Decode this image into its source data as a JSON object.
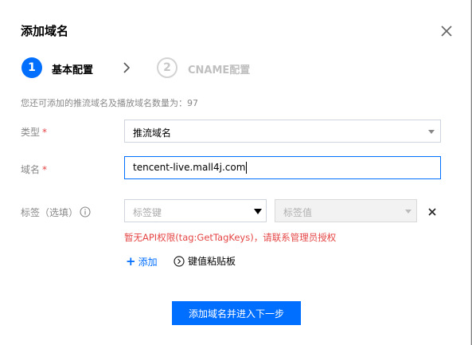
{
  "dialog": {
    "title": "添加域名",
    "close_icon": "close-icon"
  },
  "steps": [
    {
      "number": "1",
      "label": "基本配置",
      "state": "active"
    },
    {
      "number": "2",
      "label": "CNAME配置",
      "state": "inactive"
    }
  ],
  "hint": "您还可添加的推流域名及播放域名数量为：97",
  "form": {
    "type": {
      "label": "类型",
      "required_mark": "*",
      "value": "推流域名"
    },
    "domain": {
      "label": "域名",
      "required_mark": "*",
      "value": "tencent-live.mall4j.com"
    },
    "tags": {
      "label": "标签（选填）",
      "key_placeholder": "标签键",
      "value_placeholder": "标签值",
      "error": "暂无API权限(tag:GetTagKeys)，请联系管理员授权",
      "add_label": "添加",
      "paste_label": "键值粘贴板"
    }
  },
  "submit_label": "添加域名并进入下一步",
  "colors": {
    "primary": "#006eff",
    "error": "#e54545",
    "muted": "#888888"
  }
}
